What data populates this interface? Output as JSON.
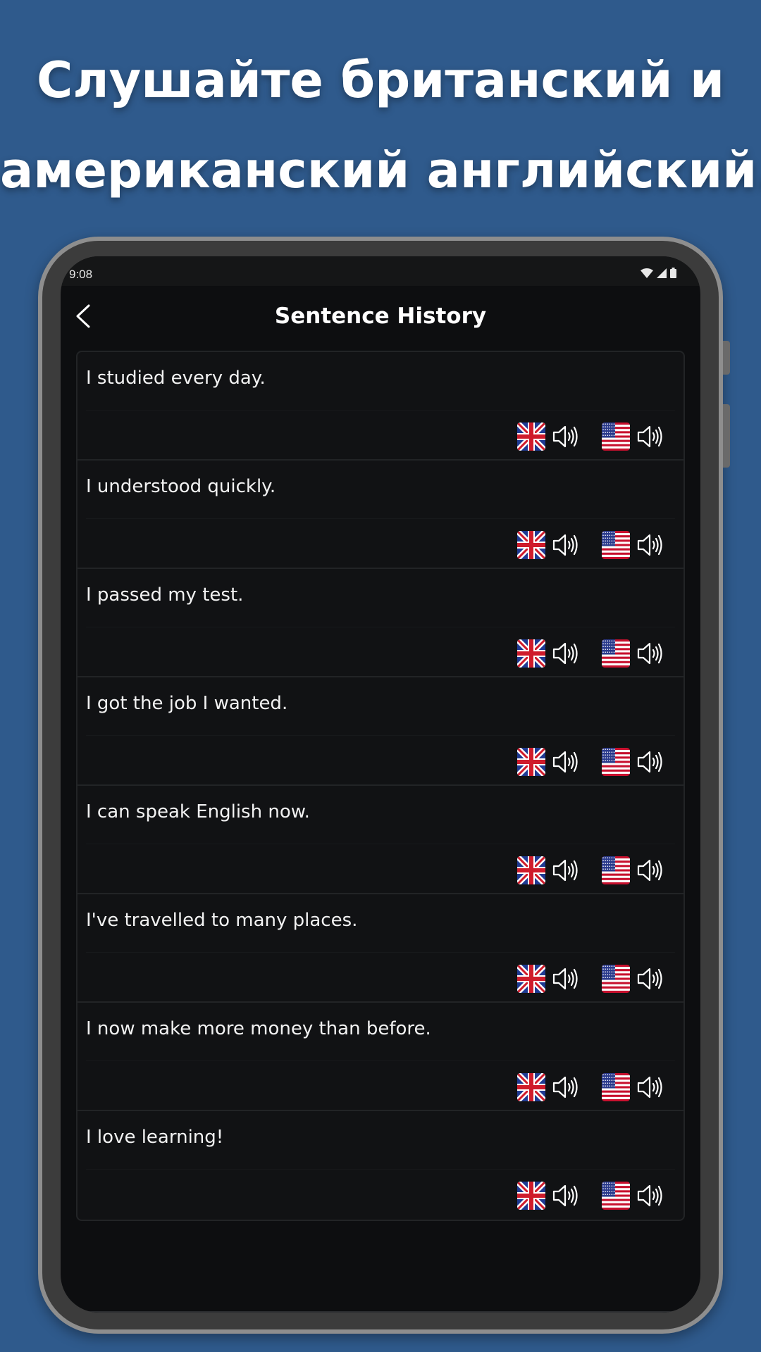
{
  "headline": {
    "line1": "Слушайте британский и",
    "line2": "американский английский."
  },
  "status_bar": {
    "time": "9:08",
    "icons": [
      "wifi-icon",
      "signal-icon",
      "battery-icon"
    ]
  },
  "app_bar": {
    "back_icon": "chevron-left-icon",
    "title": "Sentence History"
  },
  "sentences": [
    {
      "text": "I studied every day."
    },
    {
      "text": "I understood quickly."
    },
    {
      "text": "I passed my test."
    },
    {
      "text": "I got the job I wanted."
    },
    {
      "text": "I can speak English now."
    },
    {
      "text": "I've travelled to many places."
    },
    {
      "text": "I now make more money than before."
    },
    {
      "text": "I love learning!"
    }
  ],
  "audio_buttons": {
    "uk": {
      "flag": "uk-flag-icon",
      "icon": "speaker-icon"
    },
    "us": {
      "flag": "us-flag-icon",
      "icon": "speaker-icon"
    }
  },
  "colors": {
    "background": "#2f5a8c",
    "screen": "#0d0e10",
    "card": "#111214",
    "text": "#f2f2f2"
  }
}
